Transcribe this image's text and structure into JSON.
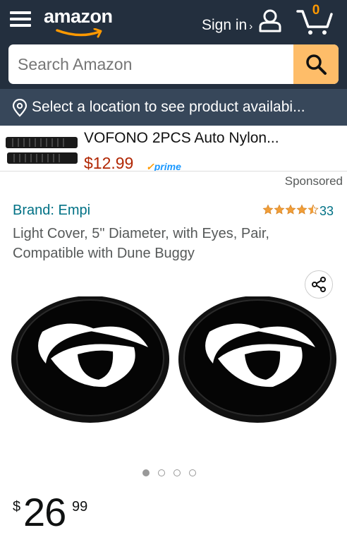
{
  "header": {
    "logo_text": "amazon",
    "signin_label": "Sign in",
    "signin_chevron": "›",
    "cart_count": "0"
  },
  "search": {
    "placeholder": "Search Amazon"
  },
  "location": {
    "text": "Select a location to see product availabi..."
  },
  "ad": {
    "title": "VOFONO 2PCS Auto Nylon...",
    "price": "$12.99",
    "prime_label": "prime"
  },
  "sponsored_label": "Sponsored",
  "product": {
    "brand": "Brand: Empi",
    "rating_stars": 4.5,
    "rating_count": "33",
    "title": "Light Cover, 5\" Diameter, with Eyes, Pair, Compatible with Dune Buggy",
    "image_count": 4,
    "active_image_index": 0,
    "price": {
      "symbol": "$",
      "whole": "26",
      "fraction": "99"
    }
  },
  "icons": {
    "menu": "hamburger-menu-icon",
    "user": "user-icon",
    "cart": "cart-icon",
    "search": "search-icon",
    "location": "location-pin-icon",
    "share": "share-icon"
  },
  "colors": {
    "header_bg": "#232f3e",
    "location_bg": "#37475a",
    "search_button": "#febd69",
    "accent_orange": "#ff9900",
    "link_teal": "#007185",
    "price_red": "#b12704"
  }
}
